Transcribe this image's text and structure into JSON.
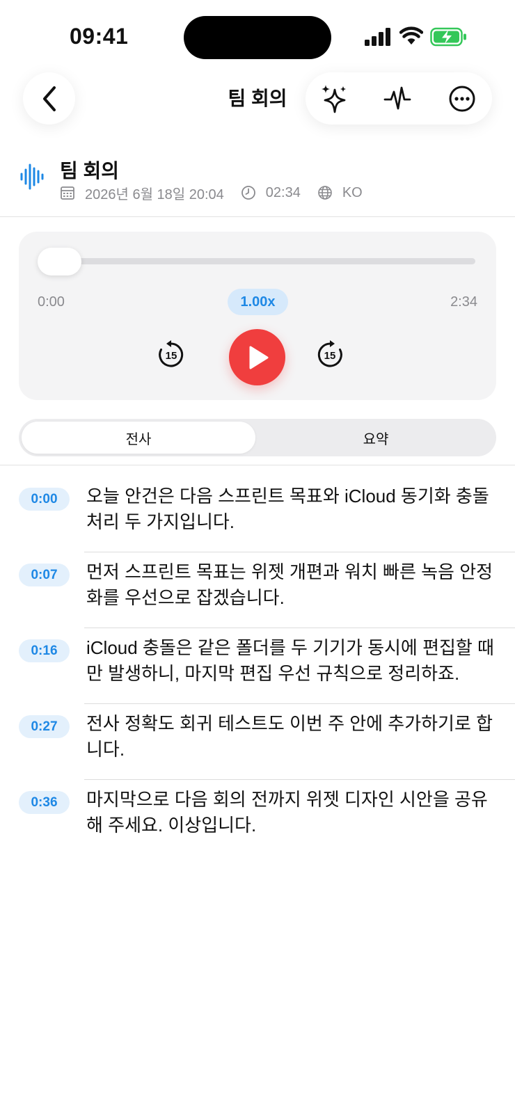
{
  "status_bar": {
    "time": "09:41"
  },
  "nav": {
    "title": "팀 회의"
  },
  "recording": {
    "title": "팀 회의",
    "date": "2026년 6월 18일 20:04",
    "duration": "02:34",
    "language": "KO"
  },
  "player": {
    "current_time": "0:00",
    "total_time": "2:34",
    "speed": "1.00x",
    "progress": 0.0,
    "skip_back_seconds": "15",
    "skip_forward_seconds": "15",
    "accent_color": "#f03e3e"
  },
  "tabs": {
    "transcript": "전사",
    "summary": "요약",
    "selected": "전사"
  },
  "transcript": [
    {
      "time": "0:00",
      "text": "오늘 안건은 다음 스프린트 목표와 iCloud 동기화 충돌 처리 두 가지입니다."
    },
    {
      "time": "0:07",
      "text": "먼저 스프린트 목표는 위젯 개편과 워치 빠른 녹음 안정화를 우선으로 잡겠습니다."
    },
    {
      "time": "0:16",
      "text": "iCloud 충돌은 같은 폴더를 두 기기가 동시에 편집할 때만 발생하니, 마지막 편집 우선 규칙으로 정리하죠."
    },
    {
      "time": "0:27",
      "text": "전사 정확도 회귀 테스트도 이번 주 안에 추가하기로 합니다."
    },
    {
      "time": "0:36",
      "text": "마지막으로 다음 회의 전까지 위젯 디자인 시안을 공유해 주세요. 이상입니다."
    }
  ],
  "colors": {
    "brand_blue": "#1e88e5",
    "battery_green": "#34c759"
  },
  "icons": [
    "back-icon",
    "sparkles-icon",
    "waveform-icon",
    "more-icon",
    "calendar-icon",
    "clock-icon",
    "globe-icon",
    "skip-back-15-icon",
    "play-icon",
    "skip-forward-15-icon"
  ]
}
